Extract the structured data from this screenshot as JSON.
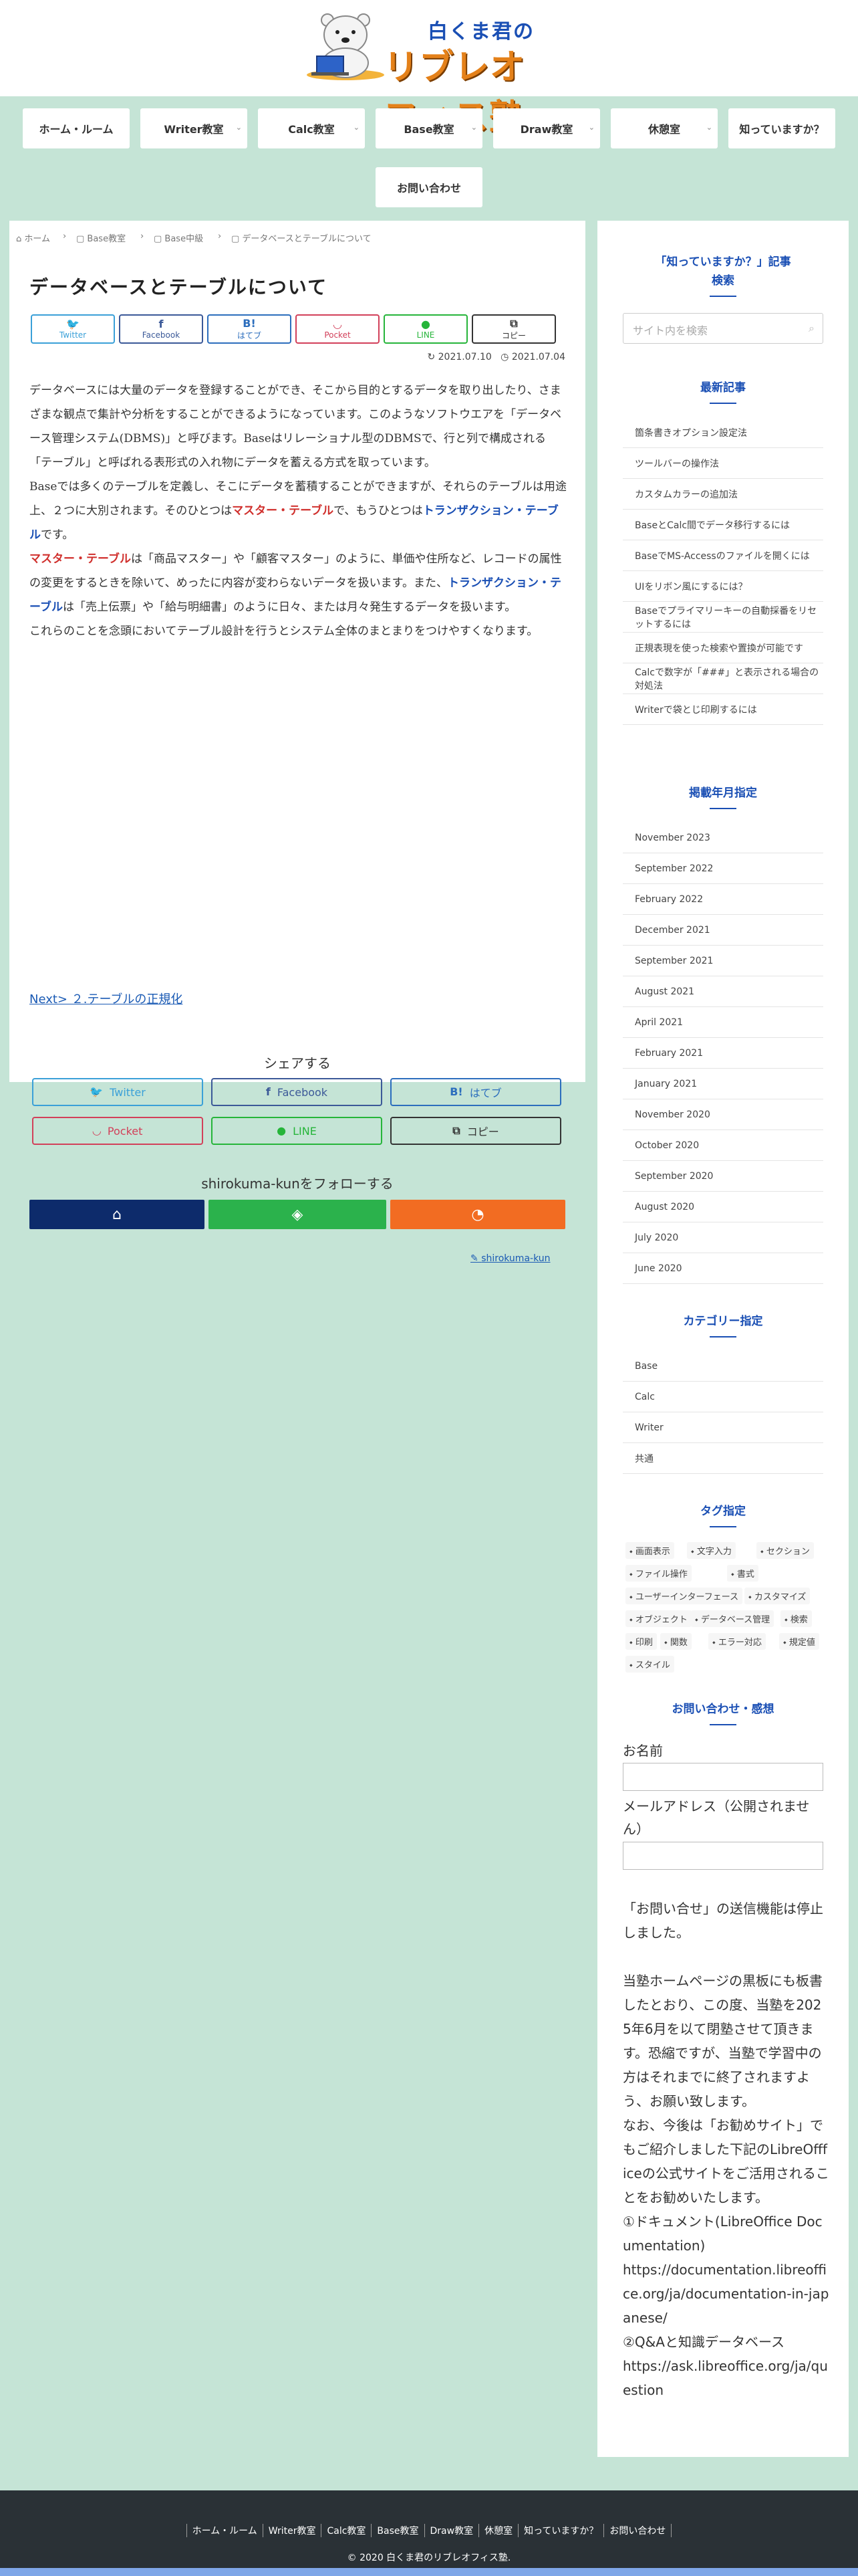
{
  "site": {
    "title_line1": "白くま君の",
    "title_line2": "リブレオフィス塾"
  },
  "nav": {
    "items": [
      {
        "label": "ホーム・ルーム"
      },
      {
        "label": "Writer教室"
      },
      {
        "label": "Calc教室"
      },
      {
        "label": "Base教室"
      },
      {
        "label": "Draw教室"
      },
      {
        "label": "休憩室"
      },
      {
        "label": "知っていますか？"
      },
      {
        "label": "お問い合わせ"
      }
    ]
  },
  "breadcrumb": [
    "ホーム",
    "Base教室",
    "Base中級",
    "データベースとテーブルについて"
  ],
  "article": {
    "title": "データベースとテーブルについて",
    "updated": "2021.07.10",
    "published": "2021.07.04",
    "p1": "データベースには大量のデータを登録することができ、そこから目的とするデータを取り出したり、さまざまな観点で集計や分析をすることができるようになっています。このようなソフトウエアを「データベース管理システム(DBMS)」と呼びます。Baseはリレーショナル型のDBMSで、行と列で構成される「テーブル」と呼ばれる表形式の入れ物にデータを蓄える方式を取っています。",
    "p2_a": "Baseでは多くのテーブルを定義し、そこにデータを蓄積することができますが、それらのテーブルは用途上、２つに大別されます。そのひとつは",
    "p2_red": "マスター・テーブル",
    "p2_b": "で、もうひとつは",
    "p2_blue": "トランザクション・テーブル",
    "p2_c": "です。",
    "p3_red": "マスター・テーブル",
    "p3_a": "は「商品マスター」や「顧客マスター」のように、単価や住所など、レコードの属性の変更をするときを除いて、めったに内容が変わらないデータを扱います。また、",
    "p3_blue": "トランザクション・テーブル",
    "p3_b": "は「売上伝票」や「給与明細書」のように日々、または月々発生するデータを扱います。",
    "p4": "これらのことを念頭においてテーブル設計を行うとシステム全体のまとまりをつけやすくなります。",
    "next_link": "Next> ２.テーブルの正規化",
    "share_title": "シェアする",
    "follow_title": "shirokuma-kunをフォローする",
    "author": "shirokuma-kun"
  },
  "share": {
    "twitter": "Twitter",
    "facebook": "Facebook",
    "hatena": "はてブ",
    "pocket": "Pocket",
    "line": "LINE",
    "copy": "コピー",
    "hatena_icon": "B!"
  },
  "colors": {
    "twitter": "#3aa0d8",
    "facebook": "#3b5998",
    "hatena": "#2c6ebd",
    "pocket": "#d2405a",
    "line": "#26b53a",
    "copy": "#333333",
    "follow_home": "#0d2b6b",
    "follow_feedly": "#2bb24c",
    "follow_rss": "#f26c22"
  },
  "sidebar": {
    "search_heading": "「知っていますか？」記事検索",
    "search_placeholder": "サイト内を検索",
    "recent_heading": "最新記事",
    "recent": [
      "箇条書きオプション設定法",
      "ツールバーの操作法",
      "カスタムカラーの追加法",
      "BaseとCalc間でデータ移行するには",
      "BaseでMS-Accessのファイルを開くには",
      "UIをリボン風にするには？",
      "Baseでプライマリーキーの自動採番をリセットするには",
      "正規表現を使った検索や置換が可能です",
      "Calcで数字が「###」と表示される場合の対処法",
      "Writerで袋とじ印刷するには"
    ],
    "archive_heading": "掲載年月指定",
    "archives": [
      "November 2023",
      "September 2022",
      "February 2022",
      "December 2021",
      "September 2021",
      "August 2021",
      "April 2021",
      "February 2021",
      "January 2021",
      "November 2020",
      "October 2020",
      "September 2020",
      "August 2020",
      "July 2020",
      "June 2020"
    ],
    "category_heading": "カテゴリー指定",
    "categories": [
      "Base",
      "Calc",
      "Writer",
      "共通"
    ],
    "tag_heading": "タグ指定",
    "tags": [
      "画面表示",
      "文字入力",
      "セクション",
      "ファイル操作",
      "書式",
      "ユーザーインターフェース",
      "カスタマイズ",
      "オブジェクト",
      "データベース管理",
      "検索",
      "印刷",
      "関数",
      "エラー対応",
      "規定値",
      "スタイル"
    ],
    "contact_heading": "お問い合わせ・感想",
    "name_label": "お名前",
    "email_label": "メールアドレス（公開されません）",
    "notice_1": "「お問い合せ」の送信機能は停止しました。",
    "notice_2": "当塾ホームページの黒板にも板書したとおり、この度、当塾を2025年6月を以て閉塾させて頂きます。恐縮ですが、当塾で学習中の方はそれまでに終了されますよう、お願い致します。",
    "notice_3": "なお、今後は「お勧めサイト」でもご紹介しました下記のLibreOffficeの公式サイトをご活用されることをお勧めいたします。",
    "notice_4": "①ドキュメント(LibreOffice Documentation)",
    "notice_5": "https://documentation.libreoffice.org/ja/documentation-in-japanese/",
    "notice_6": "②Q&Aと知識データベース",
    "notice_7": "https://ask.libreoffice.org/ja/question"
  },
  "footer": {
    "nav": [
      "ホーム・ルーム",
      "Writer教室",
      "Calc教室",
      "Base教室",
      "Draw教室",
      "休憩室",
      "知っていますか？",
      "お問い合わせ"
    ],
    "copyright": "© 2020 白くま君のリブレオフィス塾."
  }
}
